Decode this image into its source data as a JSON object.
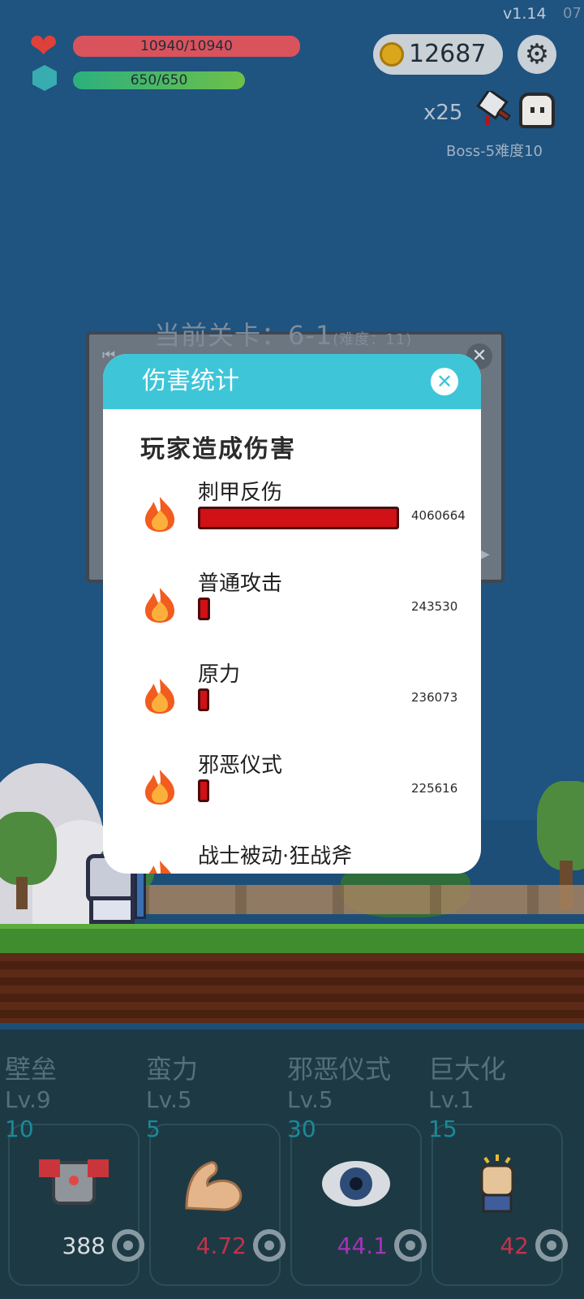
{
  "app": {
    "version": "v1.14",
    "version_extra": "07"
  },
  "hud": {
    "hp_text": "10940/10940",
    "hp_fraction": 1.0,
    "mp_text": "650/650",
    "mp_fraction": 1.0,
    "coins": "12687",
    "multiplier": "x25",
    "boss_label": "Boss-5难度10"
  },
  "stage": {
    "title": "当前关卡：6-1",
    "difficulty": "(难度：11)"
  },
  "modal": {
    "title": "伤害统计",
    "close_icon": "close-icon",
    "section_title": "玩家造成伤害",
    "rows": [
      {
        "name": "刺甲反伤",
        "value": "4060664",
        "fraction": 1.0
      },
      {
        "name": "普通攻击",
        "value": "243530",
        "fraction": 0.06
      },
      {
        "name": "原力",
        "value": "236073",
        "fraction": 0.058
      },
      {
        "name": "邪恶仪式",
        "value": "225616",
        "fraction": 0.056
      },
      {
        "name": "战士被动·狂战斧",
        "value": "",
        "fraction": 0
      }
    ]
  },
  "skills": [
    {
      "name": "壁垒",
      "level": "Lv.9",
      "cost": "10",
      "value": "388",
      "value_color": "#d8dde2",
      "icon": "armor-icon"
    },
    {
      "name": "蛮力",
      "level": "Lv.5",
      "cost": "5",
      "value": "4.72",
      "value_color": "#c0344a",
      "icon": "muscle-arm-icon"
    },
    {
      "name": "邪恶仪式",
      "level": "Lv.5",
      "cost": "30",
      "value": "44.1",
      "value_color": "#a532b8",
      "icon": "eye-icon"
    },
    {
      "name": "巨大化",
      "level": "Lv.1",
      "cost": "15",
      "value": "42",
      "value_color": "#c0344a",
      "icon": "raised-fist-icon"
    }
  ],
  "colors": {
    "accent": "#3ec6d8",
    "damage_bar": "#d01116",
    "hp_bar": "#d9535d"
  }
}
